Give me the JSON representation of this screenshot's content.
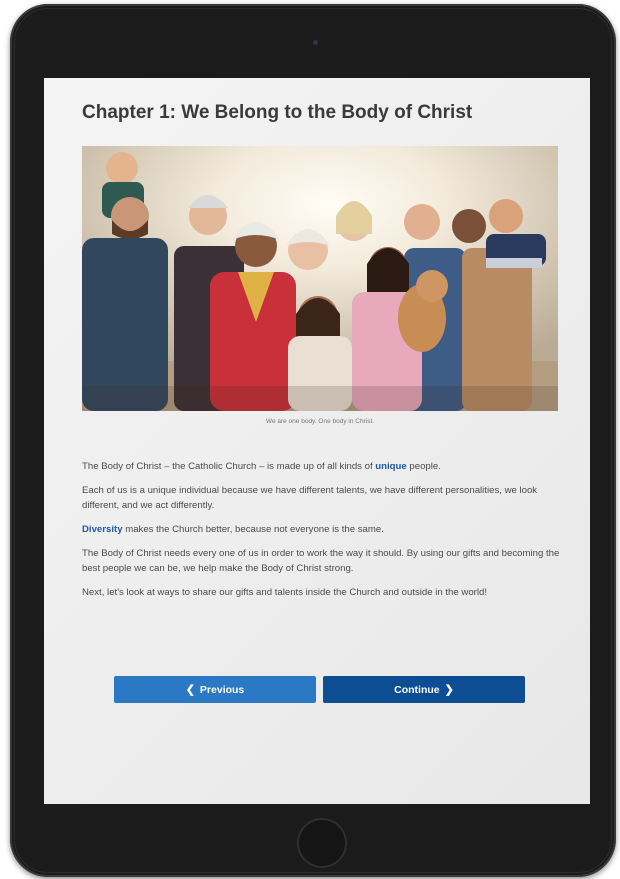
{
  "page": {
    "title": "Chapter 1: We Belong to the Body of Christ",
    "image_caption": "We are one body. One body in Christ.",
    "paragraphs": [
      {
        "before": "The Body of Christ – the Catholic Church – is made up of all kinds of ",
        "highlight": "unique",
        "after": " people."
      },
      {
        "before": "Each of us is a unique individual because we have different talents, we have different personalities, we look different, and we act differently.",
        "highlight": "",
        "after": ""
      },
      {
        "before": "",
        "highlight": "Diversity",
        "after": " makes the Church better, because not everyone is the same."
      },
      {
        "before": "The Body of Christ needs every one of us in order to work the way it should. By using our gifts and becoming the best people we can be, we help make the Body of Christ strong.",
        "highlight": "",
        "after": ""
      },
      {
        "before": "Next, let's look at ways to share our gifts and talents inside the Church and outside in the world!",
        "highlight": "",
        "after": ""
      }
    ]
  },
  "nav": {
    "previous_label": "Previous",
    "continue_label": "Continue",
    "previous_icon": "chevron-left-icon",
    "continue_icon": "chevron-right-icon"
  },
  "colors": {
    "highlight": "#1e5aa8",
    "previous_button": "#2b79c4",
    "continue_button": "#0d4d93"
  }
}
